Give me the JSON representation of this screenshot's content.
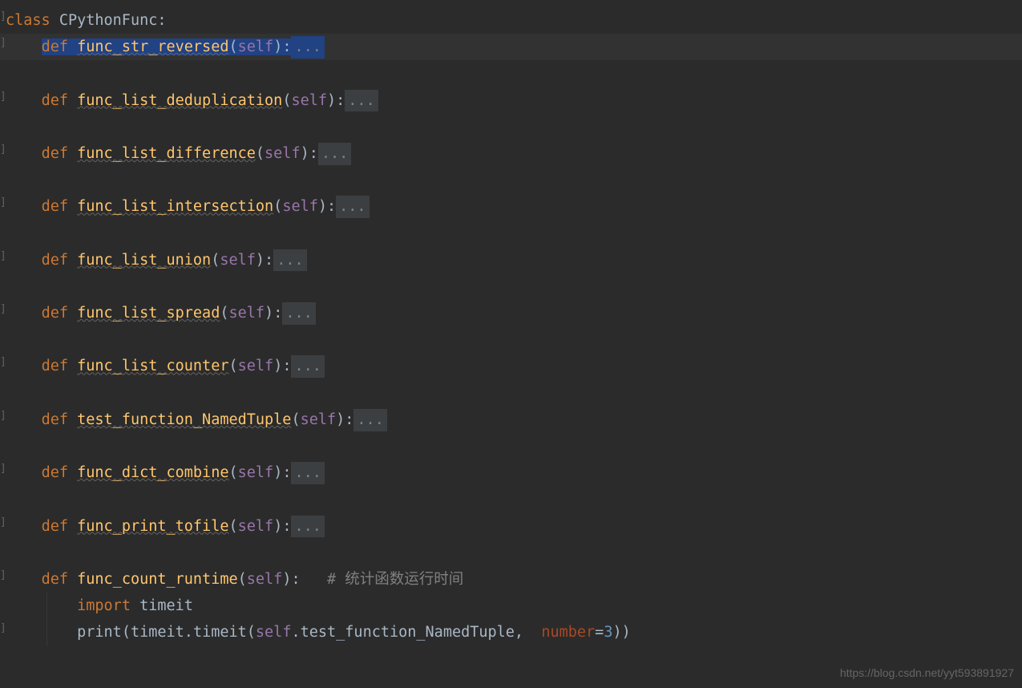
{
  "keywords": {
    "class": "class",
    "def": "def",
    "import": "import"
  },
  "class_name": "CPythonFunc",
  "self": "self",
  "fold": "...",
  "methods": {
    "m1": "func_str_reversed",
    "m2": "func_list_deduplication",
    "m3": "func_list_difference",
    "m4": "func_list_intersection",
    "m5": "func_list_union",
    "m6": "func_list_spread",
    "m7": "func_list_counter",
    "m8": "test_function_NamedTuple",
    "m9": "func_dict_combine",
    "m10": "func_print_tofile",
    "m11": "func_count_runtime"
  },
  "comment": "# 统计函数运行时间",
  "import_mod": "timeit",
  "print_line": {
    "print": "print",
    "timeit1": "timeit",
    "timeit2": "timeit",
    "call": "test_function_NamedTuple",
    "param_name": "number",
    "param_val": "3"
  },
  "watermark": "https://blog.csdn.net/yyt593891927"
}
